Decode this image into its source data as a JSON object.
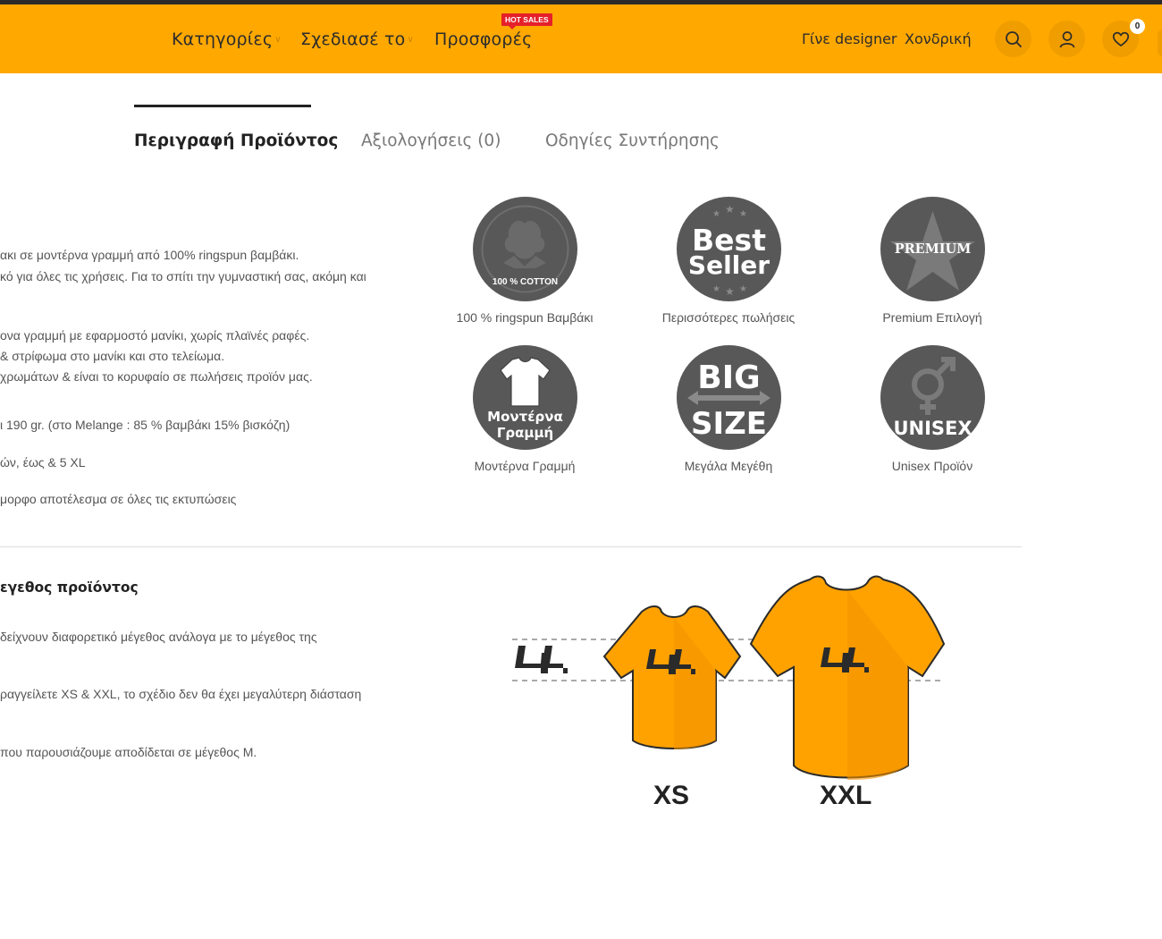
{
  "header": {
    "nav": [
      {
        "label": "Κατηγορίες",
        "has_dropdown": true
      },
      {
        "label": "Σχεδιασέ το",
        "has_dropdown": true
      },
      {
        "label": "Προσφορές",
        "has_dropdown": false,
        "badge": "HOT SALES"
      }
    ],
    "links": [
      "Γίνε designer",
      "Χονδρική"
    ],
    "icons": [
      "search-icon",
      "user-icon",
      "heart-icon"
    ],
    "wishlist_count": "0",
    "accent_color": "#ffa800",
    "badge_color": "#e5202a"
  },
  "tabs": [
    {
      "label": "Περιγραφή Προϊόντος",
      "active": true
    },
    {
      "label": "Αξιολογήσεις (0)",
      "active": false
    },
    {
      "label": "Οδηγίες Συντήρησης",
      "active": false
    }
  ],
  "description": {
    "lines": [
      "ακι σε μοντέρνα γραμμή από 100% ringspun βαμβάκι.",
      "κό για όλες τις χρήσεις. Για το σπίτι την γυμναστική σας, ακόμη και",
      "ονα γραμμή με εφαρμοστό μανίκι, χωρίς πλαϊνές ραφές.",
      "& στρίφωμα στο μανίκι και στο τελείωμα.",
      " χρωμάτων & είναι το κορυφαίο σε πωλήσεις προϊόν μας.",
      "ι 190 gr. (στο Melange : 85 % βαμβάκι 15% βισκόζη)",
      "ών, έως & 5 XL",
      "μορφο αποτέλεσμα σε όλες τις εκτυπώσεις"
    ]
  },
  "features": [
    {
      "label": "100 % ringspun Βαμβάκι",
      "icon_text": "100 % COTTON",
      "icon": "cotton-icon"
    },
    {
      "label": "Περισσότερες πωλήσεις",
      "icon_text_1": "Best",
      "icon_text_2": "Seller",
      "icon": "best-seller-icon"
    },
    {
      "label": "Premium Επιλογή",
      "icon_text": "PREMIUM",
      "icon": "premium-icon"
    },
    {
      "label": "Μοντέρνα Γραμμή",
      "icon_text_1": "Μοντέρνα",
      "icon_text_2": "Γραμμή",
      "icon": "tshirt-icon"
    },
    {
      "label": "Μεγάλα Μεγέθη",
      "icon_text_1": "BIG",
      "icon_text_2": "SIZE",
      "icon": "big-size-icon"
    },
    {
      "label": "Unisex Προϊόν",
      "icon_text": "UNISEX",
      "icon": "unisex-icon"
    }
  ],
  "size_section": {
    "heading": "εγεθος προϊόντος",
    "lines": [
      "δείχνουν διαφορετικό μέγεθος ανάλογα με το μέγεθος της",
      "ραγγείλετε XS & XXL, το σχέδιο δεν θα έχει μεγαλύτερη διάσταση",
      " που παρουσιάζουμε αποδίδεται σε μέγεθος M."
    ],
    "sizes": [
      "XS",
      "XXL"
    ],
    "shirt_color": "#ffa200"
  }
}
